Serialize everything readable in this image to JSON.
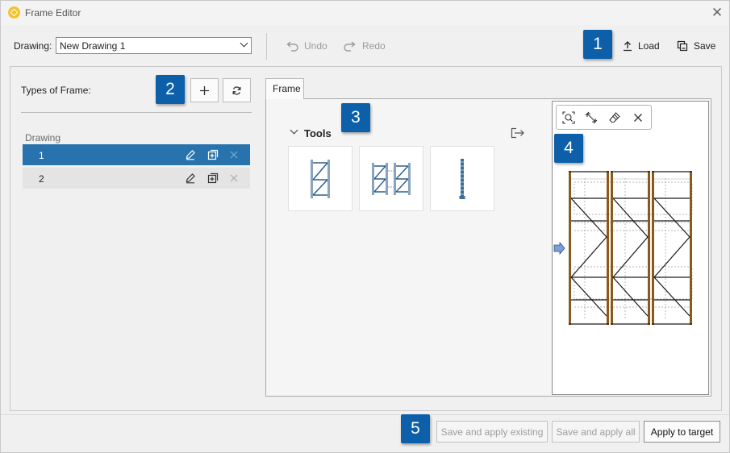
{
  "window": {
    "title": "Frame Editor"
  },
  "toolbar": {
    "drawing_label": "Drawing:",
    "drawing_value": "New Drawing 1",
    "undo_label": "Undo",
    "redo_label": "Redo",
    "load_label": "Load",
    "save_label": "Save"
  },
  "badges": [
    "1",
    "2",
    "3",
    "4",
    "5"
  ],
  "left": {
    "types_label": "Types of Frame:",
    "group_label": "Drawing",
    "rows": [
      {
        "label": "1",
        "selected": true
      },
      {
        "label": "2",
        "selected": false
      }
    ]
  },
  "tabs": [
    {
      "label": "Frame",
      "active": true
    }
  ],
  "tools": {
    "label": "Tools",
    "cards": [
      "single-frame-tool",
      "double-frame-tool",
      "upright-tool"
    ]
  },
  "footer": {
    "save_apply_existing": "Save and apply existing",
    "save_apply_all": "Save and apply all",
    "apply_target": "Apply to target"
  },
  "colors": {
    "accent": "#0d5fa9",
    "selected_row": "#2873ad",
    "upright": "#8b5a1a",
    "brace": "#1a1a1a"
  }
}
